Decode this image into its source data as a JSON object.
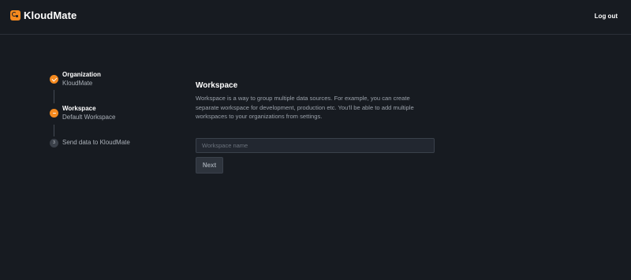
{
  "header": {
    "brand_name": "KloudMate",
    "logout_label": "Log out"
  },
  "steps": [
    {
      "title": "Organization",
      "subtitle": "KloudMate",
      "status": "completed"
    },
    {
      "title": "Workspace",
      "subtitle": "Default Workspace",
      "status": "current"
    },
    {
      "number": "3",
      "title": "Send data to KloudMate",
      "status": "pending"
    }
  ],
  "workspace_form": {
    "title": "Workspace",
    "description": "Workspace is a way to group multiple data sources. For example, you can create separate workspace for development, production etc. You'll be able to add multiple workspaces to your organizations from settings.",
    "input_value": "",
    "input_placeholder": "Workspace name",
    "next_label": "Next"
  },
  "colors": {
    "background": "#171b21",
    "accent": "#f58a1f",
    "input_bg": "#222730"
  },
  "icons": {
    "brand": "kloudmate-logo-icon",
    "step_completed": "check-icon",
    "step_current": "current-step-icon"
  }
}
